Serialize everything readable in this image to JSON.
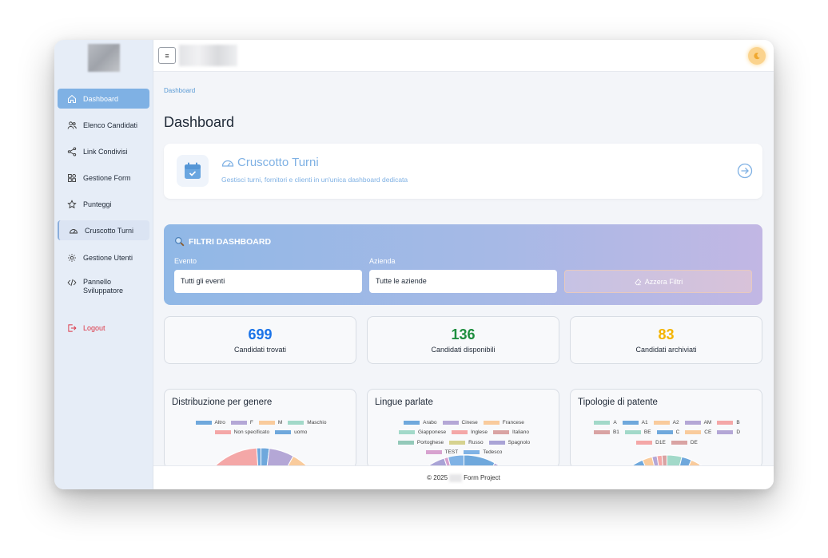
{
  "sidebar": {
    "items": [
      {
        "label": "Dashboard",
        "icon": "home-icon"
      },
      {
        "label": "Elenco Candidati",
        "icon": "users-icon"
      },
      {
        "label": "Link Condivisi",
        "icon": "share-icon"
      },
      {
        "label": "Gestione Form",
        "icon": "grid-icon"
      },
      {
        "label": "Punteggi",
        "icon": "star-icon"
      },
      {
        "label": "Cruscotto Turni",
        "icon": "gauge-icon"
      },
      {
        "label": "Gestione Utenti",
        "icon": "gear-icon"
      },
      {
        "label": "Pannello Sviluppatore",
        "icon": "code-icon"
      }
    ],
    "logout": "Logout"
  },
  "topbar": {
    "menu_icon": "≡"
  },
  "main": {
    "breadcrumb": "Dashboard",
    "title": "Dashboard",
    "cruscotto": {
      "title": "Cruscotto Turni",
      "subtitle": "Gestisci turni, fornitori e clienti in un'unica dashboard dedicata"
    },
    "filters": {
      "title": "FILTRI DASHBOARD",
      "evento_label": "Evento",
      "evento_value": "Tutti gli eventi",
      "azienda_label": "Azienda",
      "azienda_value": "Tutte le aziende",
      "reset_label": "Azzera Filtri"
    },
    "stats": [
      {
        "value": "699",
        "label": "Candidati trovati",
        "color": "#1a73e8"
      },
      {
        "value": "136",
        "label": "Candidati disponibili",
        "color": "#1e8e3e"
      },
      {
        "value": "83",
        "label": "Candidati archiviati",
        "color": "#f4b400"
      }
    ]
  },
  "chart_data": [
    {
      "type": "pie",
      "title": "Distribuzione per genere",
      "categories": [
        "Altro",
        "F",
        "M",
        "Maschio",
        "Non specificato",
        "uomo"
      ],
      "colors": [
        "#6fa8dc",
        "#b4a7d6",
        "#f9cb9c",
        "#a2d9c9",
        "#f4a7a7",
        "#6fa8dc"
      ],
      "values": [
        2,
        6,
        35,
        1,
        55,
        1
      ]
    },
    {
      "type": "pie",
      "title": "Lingue parlate",
      "categories": [
        "Arabo",
        "Cinese",
        "Francese",
        "Giapponese",
        "Inglese",
        "Italiano",
        "Portoghese",
        "Russo",
        "Spagnolo",
        "TEST",
        "Tedesco"
      ],
      "colors": [
        "#6fa8dc",
        "#b4a7d6",
        "#f9cb9c",
        "#a2d9c9",
        "#f4a7a7",
        "#d9a3a3",
        "#93c9b9",
        "#d6d28f",
        "#a9a3d6",
        "#d7a2cf",
        "#7fb2e5"
      ],
      "values": [
        8,
        10,
        15,
        3,
        30,
        20,
        2,
        2,
        5,
        1,
        4
      ]
    },
    {
      "type": "pie",
      "title": "Tipologie di patente",
      "categories": [
        "A",
        "A1",
        "A2",
        "AM",
        "B",
        "B1",
        "BE",
        "C",
        "CE",
        "D",
        "D1E",
        "DE"
      ],
      "colors": [
        "#a2d9c9",
        "#6fa8dc",
        "#f9cb9c",
        "#b4a7d6",
        "#f4a7a7",
        "#d9a3a3",
        "#a2d9c9",
        "#6fa8dc",
        "#f9cb9c",
        "#b4a7d6",
        "#f4a7a7",
        "#d9a3a3"
      ],
      "values": [
        3,
        2,
        2,
        1,
        60,
        1,
        1,
        3,
        2,
        1,
        1,
        1
      ]
    }
  ],
  "footer": {
    "prefix": "© 2025",
    "suffix": "Form Project"
  }
}
